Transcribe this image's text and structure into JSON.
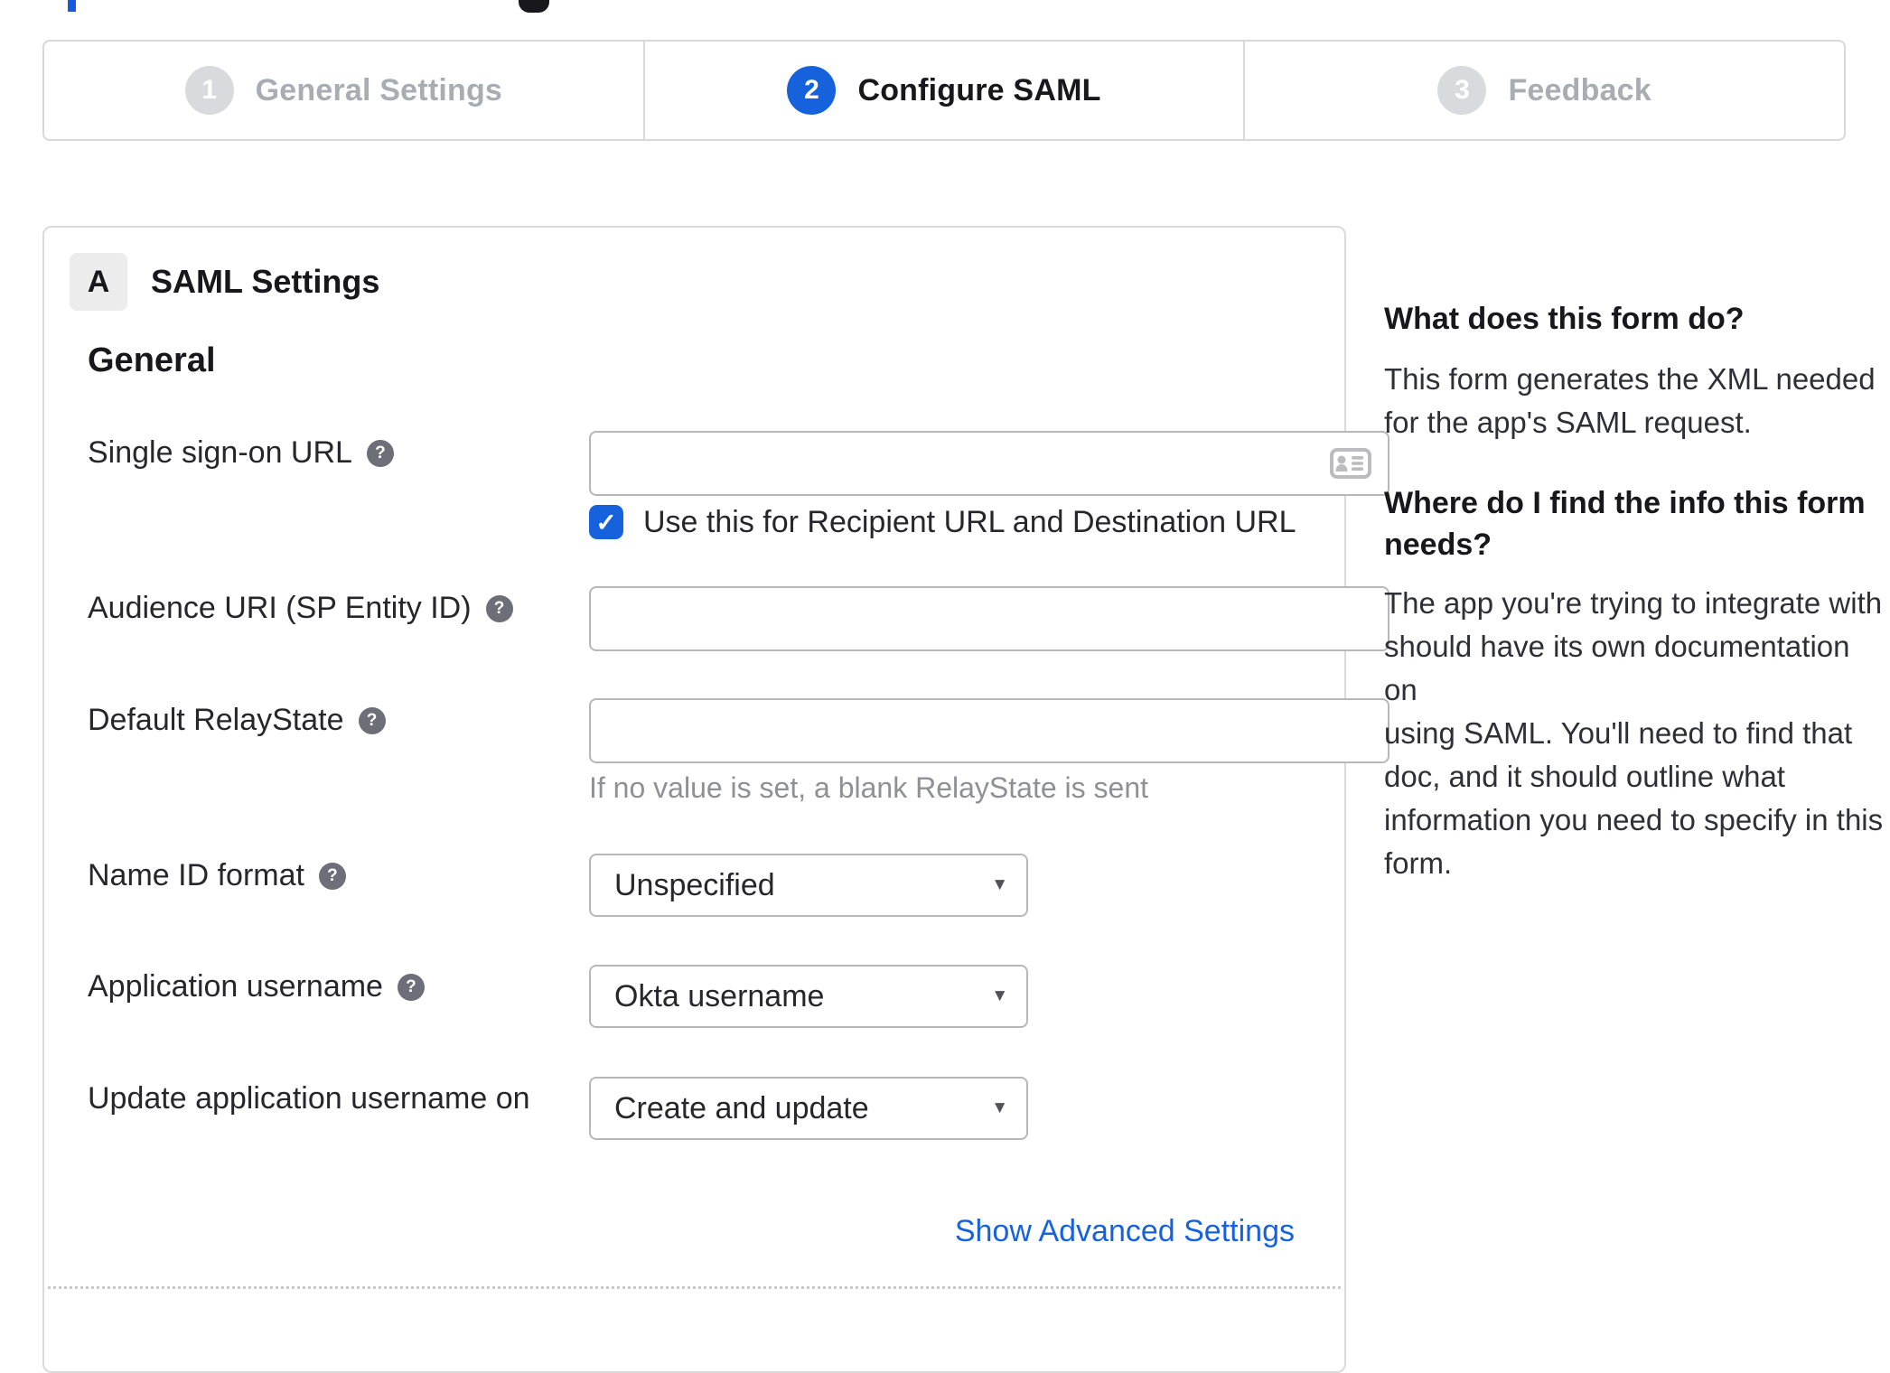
{
  "colors": {
    "accent": "#1662dd",
    "inactive_circle": "#d9dadd",
    "border": "#d8d8da"
  },
  "icons": {
    "help_glyph": "?",
    "check_glyph": "✓",
    "caret_glyph": "▼"
  },
  "stepper": {
    "steps": [
      {
        "number": "1",
        "label": "General Settings",
        "state": "inactive"
      },
      {
        "number": "2",
        "label": "Configure SAML",
        "state": "active"
      },
      {
        "number": "3",
        "label": "Feedback",
        "state": "inactive"
      }
    ]
  },
  "panel": {
    "badge": "A",
    "title": "SAML Settings",
    "group_heading": "General",
    "fields": [
      {
        "label": "Single sign-on URL",
        "type": "text",
        "value": "",
        "has_help": true,
        "checkbox": {
          "checked": true,
          "label": "Use this for Recipient URL and Destination URL"
        }
      },
      {
        "label": "Audience URI (SP Entity ID)",
        "type": "text",
        "value": "",
        "has_help": true
      },
      {
        "label": "Default RelayState",
        "type": "text",
        "value": "",
        "has_help": true,
        "hint": "If no value is set, a blank RelayState is sent"
      },
      {
        "label": "Name ID format",
        "type": "select",
        "value": "Unspecified",
        "has_help": true
      },
      {
        "label": "Application username",
        "type": "select",
        "value": "Okta username",
        "has_help": true
      },
      {
        "label": "Update application username on",
        "type": "select",
        "value": "Create and update",
        "has_help": false
      }
    ],
    "advanced_link": "Show Advanced Settings"
  },
  "sidebar": {
    "block1_heading": "What does this form do?",
    "block1_body": "This form generates the XML needed\nfor the app's SAML request.",
    "block2_heading": "Where do I find the info this form\nneeds?",
    "block2_body": "The app you're trying to integrate with\nshould have its own documentation on\nusing SAML. You'll need to find that\ndoc, and it should outline what\ninformation you need to specify in this\nform."
  }
}
